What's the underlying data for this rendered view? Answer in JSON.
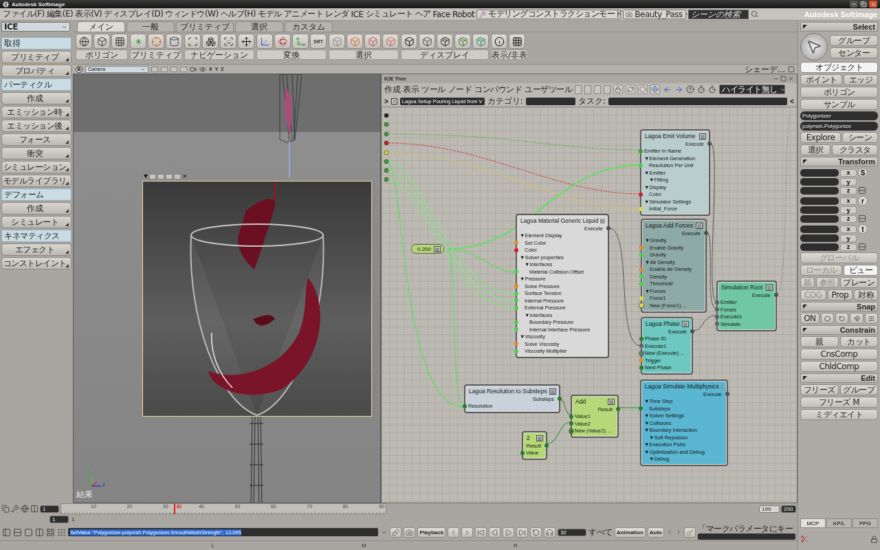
{
  "window": {
    "title": "Autodesk Softimage"
  },
  "menu_bar": {
    "items": [
      "ファイル(F)",
      "編集(E)",
      "表示(V)",
      "ディスプレイ(D)",
      "ウィンドウ(W)",
      "ヘルプ(H)",
      "モデル",
      "アニメート",
      "レンダ",
      "ICE",
      "シミュレート",
      "ヘア",
      "Face Robot"
    ],
    "mode": "モデリングコンストラクションモード",
    "pass": "Beauty_Pass",
    "search": {
      "placeholder": "シーンの検索"
    },
    "brand": "Autodesk Softimage"
  },
  "left_panel": {
    "toolbar": "ICE",
    "items": [
      {
        "kind": "header",
        "label": "取得"
      },
      {
        "kind": "button",
        "label": "プリミティブ"
      },
      {
        "kind": "button",
        "label": "プロパティ"
      },
      {
        "kind": "header",
        "label": "パーティクル"
      },
      {
        "kind": "button",
        "label": "作成"
      },
      {
        "kind": "button",
        "label": "エミッション時"
      },
      {
        "kind": "button",
        "label": "エミッション後"
      },
      {
        "kind": "button",
        "label": "フォース"
      },
      {
        "kind": "button",
        "label": "衝突"
      },
      {
        "kind": "button",
        "label": "シミュレーション"
      },
      {
        "kind": "button",
        "label": "モデルライブラリ"
      },
      {
        "kind": "header",
        "label": "デフォーム"
      },
      {
        "kind": "button",
        "label": "作成"
      },
      {
        "kind": "button",
        "label": "シミュレート"
      },
      {
        "kind": "header",
        "label": "キネマティクス"
      },
      {
        "kind": "button",
        "label": "エフェクト"
      },
      {
        "kind": "button",
        "label": "コンストレイント"
      }
    ]
  },
  "toolbar": {
    "tabs": [
      {
        "label": "メイン",
        "selected": true
      },
      {
        "label": "一般",
        "selected": false
      },
      {
        "label": "プリミティブ",
        "selected": false
      },
      {
        "label": "選択",
        "selected": false
      },
      {
        "label": "カスタム",
        "selected": false
      }
    ],
    "groups": [
      "ポリゴン",
      "プリミティブ",
      "ナビゲーション",
      "変換",
      "選択",
      "ディスプレイ",
      "表示/非表"
    ],
    "srt": "SRT"
  },
  "view_bar": {
    "view_button": "B",
    "camera": "Camera",
    "axes": [
      "X",
      "Y",
      "Z"
    ],
    "shading": "シェーデ..."
  },
  "viewport": {
    "label": "結果",
    "gizmo_labels": [
      "y",
      "z"
    ],
    "region_close": "×"
  },
  "ice_tree": {
    "title": "ICE Tree",
    "menus": [
      "作成",
      "表示",
      "ツール",
      "ノード",
      "コンパウンド",
      "ユーザツール"
    ],
    "highlight": "ハイライト無し",
    "expand": ">",
    "path": "Lagoa Setup Pouring Liquid from V",
    "category_label": "カテゴリ:",
    "task_label": "タスク:",
    "collapse": "<",
    "nodes": [
      {
        "kind": "node",
        "title": "Lagoa Emit Volume",
        "color": "#b9cdcd",
        "ports": [
          {
            "label": "Execute",
            "kind": "out",
            "color": "#505050"
          },
          {
            "label": "Emitter In Name",
            "kind": "in",
            "color": "#3a9a3a"
          },
          {
            "label": "▼Element Generation",
            "kind": "group",
            "children": [
              {
                "label": "Resolution Per Unit",
                "kind": "in",
                "color": "#4cd04c"
              }
            ]
          },
          {
            "label": "▼Emitter",
            "kind": "group",
            "children": [
              {
                "label": "▼Fitting",
                "kind": "group"
              }
            ]
          },
          {
            "label": "▼Display",
            "kind": "group",
            "children": [
              {
                "label": "Color",
                "kind": "in",
                "color": "#d02020"
              }
            ]
          },
          {
            "label": "▼Simulator Settings",
            "kind": "group",
            "children": [
              {
                "label": "Initial_Force",
                "kind": "in",
                "color": "#e0d840"
              }
            ]
          }
        ]
      },
      {
        "kind": "value",
        "title": "0.200",
        "color": "#b6d878"
      },
      {
        "kind": "node",
        "title": "Lagoa Material Generic Liquid",
        "color": "#d9d9d9",
        "ports": [
          {
            "label": "Execute",
            "kind": "out",
            "color": "#505050"
          },
          {
            "label": "▼Element Display",
            "kind": "group",
            "children": [
              {
                "label": "Set Color",
                "kind": "in",
                "color": "#e08a30"
              },
              {
                "label": "Color",
                "kind": "in",
                "color": "#d02020"
              }
            ]
          },
          {
            "label": "▼Solver properties",
            "kind": "group",
            "children": [
              {
                "label": "▼Interfaces",
                "kind": "group",
                "children": [
                  {
                    "label": "Material Collision Offset",
                    "kind": "in",
                    "color": "#4cd04c"
                  }
                ]
              }
            ]
          },
          {
            "label": "▼Pressure",
            "kind": "group",
            "children": [
              {
                "label": "Solve Pressure",
                "kind": "in",
                "color": "#e08a30"
              },
              {
                "label": "Surface Tension",
                "kind": "in",
                "color": "#4cd04c"
              },
              {
                "label": "Internal Pressure",
                "kind": "in",
                "color": "#4cd04c"
              },
              {
                "label": "External Pressure",
                "kind": "in",
                "color": "#4cd04c"
              },
              {
                "label": "▼Interfaces",
                "kind": "group",
                "children": [
                  {
                    "label": "Boundary Pressure",
                    "kind": "in",
                    "color": "#4cd04c"
                  },
                  {
                    "label": "Internal Interface Pressure",
                    "kind": "in",
                    "color": "#4cd04c"
                  }
                ]
              }
            ]
          },
          {
            "label": "▼Viscosity",
            "kind": "group",
            "children": [
              {
                "label": "Solve Viscosity",
                "kind": "in",
                "color": "#e08a30"
              },
              {
                "label": "Viscosity Multiplier",
                "kind": "in",
                "color": "#4cd04c"
              }
            ]
          }
        ]
      },
      {
        "kind": "node",
        "title": "Lagoa Add Forces",
        "color": "#8eaaa6",
        "ports": [
          {
            "label": "Execute",
            "kind": "out",
            "color": "#505050"
          },
          {
            "label": "▼Gravity",
            "kind": "group",
            "children": [
              {
                "label": "Enable Gravity",
                "kind": "in",
                "color": "#e08a30"
              },
              {
                "label": "Gravity",
                "kind": "in",
                "color": "#4cd04c"
              }
            ]
          },
          {
            "label": "▼Air Density",
            "kind": "group",
            "children": [
              {
                "label": "Enable Air Density",
                "kind": "in",
                "color": "#e08a30"
              },
              {
                "label": "Density",
                "kind": "in",
                "color": "#4cd04c"
              },
              {
                "label": "Threshold",
                "kind": "in",
                "color": "#4cd04c"
              }
            ]
          },
          {
            "label": "▼Forces",
            "kind": "group",
            "children": [
              {
                "label": "Force1",
                "kind": "in",
                "color": "#e0d840"
              },
              {
                "label": "New (Force1) ...",
                "kind": "new",
                "color": "#e0d840"
              }
            ]
          }
        ]
      },
      {
        "kind": "node",
        "title": "Simulation Root",
        "color": "#70c8a2",
        "ports": [
          {
            "label": "Execute",
            "kind": "out",
            "color": "#505050"
          },
          {
            "label": "Emitter",
            "kind": "in",
            "color": "#606060"
          },
          {
            "label": "Forces",
            "kind": "in",
            "color": "#606060"
          },
          {
            "label": "Execute1",
            "kind": "in",
            "color": "#606060"
          },
          {
            "label": "Simulate",
            "kind": "in",
            "color": "#606060"
          }
        ]
      },
      {
        "kind": "node",
        "title": "Lagoa Phase",
        "color": "#6cc8c0",
        "ports": [
          {
            "label": "Execute",
            "kind": "out",
            "color": "#505050"
          },
          {
            "label": "Phase ID",
            "kind": "in",
            "color": "#2a7a2a"
          },
          {
            "label": "Execute1",
            "kind": "in",
            "color": "#606060"
          },
          {
            "label": "New (Execute) ...",
            "kind": "new",
            "color": "#707070"
          },
          {
            "label": "Trigger",
            "kind": "in",
            "color": "#e08a30"
          },
          {
            "label": "Next Phase",
            "kind": "in",
            "color": "#2a7a2a"
          }
        ]
      },
      {
        "kind": "node",
        "title": "Lagoa Resolution to Substeps",
        "color": "#c8d2da",
        "ports": [
          {
            "label": "Substeps",
            "kind": "out",
            "color": "#2a7a2a"
          },
          {
            "label": "Resolution",
            "kind": "in",
            "color": "#2a7a2a"
          }
        ]
      },
      {
        "kind": "node",
        "title": "Lagoa Simulate Multiphysics",
        "color": "#5bb6d2",
        "ports": [
          {
            "label": "Execute",
            "kind": "out",
            "color": "#505050"
          },
          {
            "label": "▼Time Step",
            "kind": "group",
            "children": [
              {
                "label": "Substeps",
                "kind": "in",
                "color": "#2a7a2a"
              }
            ]
          },
          {
            "label": "▼Solver Settings",
            "kind": "group"
          },
          {
            "label": "▼Collisions",
            "kind": "group"
          },
          {
            "label": "▼Boundary Interaction",
            "kind": "group",
            "children": [
              {
                "label": "▼Soft Repulsion",
                "kind": "group"
              }
            ]
          },
          {
            "label": "▼Execution Ports",
            "kind": "group"
          },
          {
            "label": "▼Optimization and Debug",
            "kind": "group",
            "children": [
              {
                "label": "▼Debug",
                "kind": "group"
              }
            ]
          }
        ]
      },
      {
        "kind": "node",
        "title": "Add",
        "color": "#b6d878",
        "ports": [
          {
            "label": "Result",
            "kind": "out",
            "color": "#2a7a2a"
          },
          {
            "label": "Value1",
            "kind": "in",
            "color": "#2a7a2a"
          },
          {
            "label": "Value2",
            "kind": "in",
            "color": "#2a7a2a"
          },
          {
            "label": "New (Value2) ...",
            "kind": "new",
            "color": "#2a7a2a"
          }
        ]
      },
      {
        "kind": "node",
        "title": "2",
        "color": "#b6d878",
        "ports": [
          {
            "label": "Result",
            "kind": "out",
            "color": "#2a7a2a"
          },
          {
            "label": "Value",
            "kind": "in",
            "color": "#2a7a2a"
          }
        ]
      }
    ]
  },
  "right_panel": {
    "select": {
      "title": "Select",
      "buttons": [
        "グループ",
        "センター"
      ],
      "modes": [
        {
          "label": "オブジェクト",
          "selected": true
        },
        {
          "label": "ポイント",
          "selected": false
        },
        {
          "label": "エッジ",
          "selected": false
        },
        {
          "label": "ポリゴン",
          "selected": false
        }
      ],
      "sample": "サンプル",
      "fields": [
        "Polygonizer",
        "polymsh.Polygonize"
      ],
      "actions": [
        "Explore",
        "シーン",
        "選択",
        "クラスタ"
      ]
    },
    "transform": {
      "title": "Transform",
      "groups": [
        {
          "key": "S",
          "axes": [
            "x",
            "y",
            "z"
          ]
        },
        {
          "key": "r",
          "axes": [
            "x",
            "y",
            "z"
          ]
        },
        {
          "key": "t",
          "axes": [
            "x",
            "y",
            "z"
          ]
        }
      ],
      "spaces": [
        {
          "label": "グローバル",
          "selected": false,
          "disabled": true
        },
        {
          "label": "ローカル",
          "selected": false,
          "disabled": true
        },
        {
          "label": "ビュー",
          "selected": true,
          "disabled": false
        }
      ],
      "refs": [
        {
          "label": "親",
          "disabled": true
        },
        {
          "label": "参照",
          "disabled": true
        },
        {
          "label": "プレーン",
          "disabled": false
        }
      ],
      "extra": [
        {
          "label": "COG",
          "disabled": true
        },
        {
          "label": "Prop",
          "disabled": false
        },
        {
          "label": "対称",
          "disabled": false
        }
      ]
    },
    "snap": {
      "title": "Snap",
      "on": "ON"
    },
    "constrain": {
      "title": "Constrain",
      "buttons": [
        "親",
        "カット",
        "CnsComp",
        "ChldComp"
      ]
    },
    "edit": {
      "title": "Edit",
      "buttons": [
        "フリーズ",
        "グループ",
        "フリーズ M",
        "ミディエイト"
      ]
    },
    "tabs": [
      {
        "label": "MCP",
        "selected": true
      },
      {
        "label": "KP/L",
        "selected": false
      },
      {
        "label": "PPG",
        "selected": false
      }
    ]
  },
  "timeline": {
    "start": "1",
    "ticks": [
      "10",
      "20",
      "30",
      "40",
      "50",
      "60",
      "70",
      "80",
      "90"
    ],
    "current": "32",
    "end_fields": [
      "199",
      "200"
    ],
    "range_start": "1",
    "range_label": "1"
  },
  "command_bar": {
    "command": "SetValue \"Polygonizer.polymsh.Polygonizer.SmoothMeshStrength\", 13.095",
    "playback": "Playback",
    "frame": "32",
    "all": "すべて",
    "animation": "Animation",
    "auto": "Auto",
    "key_label": "「マークパラメータにキー"
  },
  "bottom_strip": [
    "L",
    "M",
    "R"
  ]
}
